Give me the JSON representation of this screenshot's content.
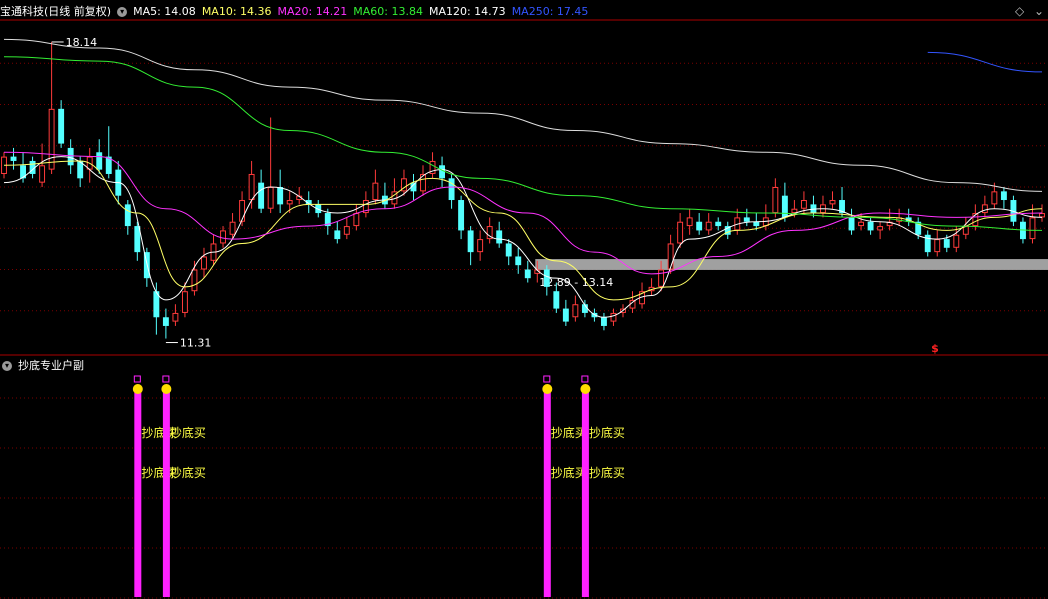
{
  "header": {
    "stock": "宝通科技(日线 前复权)",
    "ma": [
      {
        "label": "MA5: 14.08",
        "color": "#ffffff"
      },
      {
        "label": "MA10: 14.36",
        "color": "#ffff66"
      },
      {
        "label": "MA20: 14.21",
        "color": "#ff33ff"
      },
      {
        "label": "MA60: 13.84",
        "color": "#33ee33"
      },
      {
        "label": "MA120: 14.73",
        "color": "#ffffff"
      },
      {
        "label": "MA250: 17.45",
        "color": "#3355ff"
      }
    ]
  },
  "sub_header": {
    "title": "抄底专业户副"
  },
  "colors": {
    "up": "#ff3b3b",
    "down": "#54ffff",
    "grid": "#7a0000",
    "ma5": "#ffffff",
    "ma10": "#ffff66",
    "ma20": "#ff33ff",
    "ma60": "#33ee33",
    "ma120": "#dddddd",
    "ma250": "#3355ff",
    "signal": "#ff22ff",
    "signal_text": "#ffff44",
    "dot": "#ffdd00"
  },
  "chart_data": {
    "type": "candlestick",
    "y_range": [
      11.0,
      18.6
    ],
    "bar_count": 110,
    "annotations": {
      "high_label": "18.14",
      "low_label": "11.31",
      "zone_label": "12.89 - 13.14",
      "zone_range": [
        12.89,
        13.14
      ],
      "marker": "$"
    },
    "signal_label": "抄底买",
    "signals": [
      14,
      17,
      57,
      61
    ],
    "ma250_visible_from": 97,
    "candles": [
      [
        15.1,
        15.5,
        15.6,
        15.0
      ],
      [
        15.5,
        15.4,
        15.7,
        15.2
      ],
      [
        15.3,
        15.0,
        15.6,
        14.9
      ],
      [
        15.4,
        15.1,
        15.5,
        15.0
      ],
      [
        14.9,
        15.3,
        15.8,
        14.8
      ],
      [
        15.2,
        16.6,
        18.14,
        15.1
      ],
      [
        16.6,
        15.8,
        16.8,
        15.7
      ],
      [
        15.7,
        15.3,
        15.9,
        15.1
      ],
      [
        15.4,
        15.0,
        15.5,
        14.8
      ],
      [
        15.2,
        15.5,
        15.7,
        14.9
      ],
      [
        15.6,
        15.2,
        15.9,
        15.1
      ],
      [
        15.5,
        15.1,
        16.2,
        15.0
      ],
      [
        15.2,
        14.6,
        15.4,
        14.4
      ],
      [
        14.4,
        13.9,
        14.5,
        13.7
      ],
      [
        13.9,
        13.3,
        14.0,
        13.1
      ],
      [
        13.3,
        12.7,
        13.4,
        12.5
      ],
      [
        12.4,
        11.8,
        12.6,
        11.4
      ],
      [
        11.8,
        11.6,
        12.0,
        11.31
      ],
      [
        11.7,
        11.9,
        12.1,
        11.6
      ],
      [
        11.9,
        12.4,
        12.6,
        11.8
      ],
      [
        12.4,
        12.9,
        13.1,
        12.3
      ],
      [
        12.9,
        13.2,
        13.4,
        12.7
      ],
      [
        13.1,
        13.5,
        13.7,
        13.0
      ],
      [
        13.5,
        13.8,
        13.9,
        13.4
      ],
      [
        13.7,
        14.0,
        14.2,
        13.6
      ],
      [
        14.0,
        14.5,
        14.7,
        13.9
      ],
      [
        14.5,
        15.1,
        15.4,
        14.3
      ],
      [
        14.9,
        14.3,
        15.2,
        14.2
      ],
      [
        14.3,
        14.8,
        16.4,
        14.2
      ],
      [
        14.8,
        14.4,
        15.2,
        14.2
      ],
      [
        14.4,
        14.5,
        14.7,
        14.2
      ],
      [
        14.5,
        14.6,
        14.8,
        14.4
      ],
      [
        14.5,
        14.4,
        14.7,
        14.2
      ],
      [
        14.4,
        14.2,
        14.5,
        14.1
      ],
      [
        14.2,
        13.9,
        14.3,
        13.7
      ],
      [
        13.8,
        13.6,
        14.0,
        13.5
      ],
      [
        13.7,
        13.9,
        14.1,
        13.6
      ],
      [
        13.9,
        14.2,
        14.4,
        13.8
      ],
      [
        14.2,
        14.5,
        14.7,
        14.1
      ],
      [
        14.5,
        14.9,
        15.2,
        14.4
      ],
      [
        14.6,
        14.4,
        14.9,
        14.3
      ],
      [
        14.4,
        14.7,
        15.0,
        14.3
      ],
      [
        14.7,
        15.0,
        15.2,
        14.6
      ],
      [
        14.9,
        14.7,
        15.1,
        14.5
      ],
      [
        14.7,
        15.1,
        15.3,
        14.6
      ],
      [
        15.1,
        15.4,
        15.6,
        15.0
      ],
      [
        15.3,
        15.0,
        15.5,
        14.8
      ],
      [
        15.0,
        14.5,
        15.1,
        14.3
      ],
      [
        14.5,
        13.8,
        14.6,
        13.6
      ],
      [
        13.8,
        13.3,
        13.9,
        13.0
      ],
      [
        13.3,
        13.6,
        13.8,
        13.1
      ],
      [
        13.6,
        13.9,
        14.1,
        13.5
      ],
      [
        13.8,
        13.5,
        14.0,
        13.4
      ],
      [
        13.5,
        13.2,
        13.6,
        13.0
      ],
      [
        13.2,
        13.0,
        13.4,
        12.8
      ],
      [
        12.9,
        12.7,
        13.1,
        12.6
      ],
      [
        12.8,
        12.9,
        13.1,
        12.6
      ],
      [
        12.9,
        12.5,
        13.0,
        12.3
      ],
      [
        12.4,
        12.0,
        12.6,
        11.9
      ],
      [
        12.0,
        11.7,
        12.2,
        11.6
      ],
      [
        11.8,
        12.1,
        12.3,
        11.7
      ],
      [
        12.1,
        11.9,
        12.2,
        11.8
      ],
      [
        11.9,
        11.8,
        12.0,
        11.7
      ],
      [
        11.8,
        11.6,
        11.9,
        11.5
      ],
      [
        11.7,
        11.9,
        12.0,
        11.6
      ],
      [
        11.9,
        12.0,
        12.1,
        11.8
      ],
      [
        12.0,
        12.2,
        12.4,
        11.9
      ],
      [
        12.1,
        12.4,
        12.6,
        12.0
      ],
      [
        12.4,
        12.5,
        12.7,
        12.3
      ],
      [
        12.5,
        12.9,
        13.1,
        12.4
      ],
      [
        12.9,
        13.5,
        13.7,
        12.8
      ],
      [
        13.5,
        14.0,
        14.2,
        13.4
      ],
      [
        13.9,
        14.1,
        14.3,
        13.7
      ],
      [
        14.0,
        13.8,
        14.2,
        13.7
      ],
      [
        13.8,
        14.0,
        14.2,
        13.7
      ],
      [
        14.0,
        13.9,
        14.1,
        13.8
      ],
      [
        13.9,
        13.7,
        14.0,
        13.6
      ],
      [
        13.8,
        14.1,
        14.3,
        13.7
      ],
      [
        14.1,
        14.0,
        14.3,
        13.9
      ],
      [
        14.0,
        13.9,
        14.2,
        13.8
      ],
      [
        13.9,
        14.1,
        14.4,
        13.8
      ],
      [
        14.2,
        14.8,
        15.0,
        14.1
      ],
      [
        14.6,
        14.1,
        14.9,
        14.0
      ],
      [
        14.2,
        14.3,
        14.5,
        14.1
      ],
      [
        14.3,
        14.5,
        14.7,
        14.2
      ],
      [
        14.4,
        14.2,
        14.6,
        14.1
      ],
      [
        14.2,
        14.4,
        14.6,
        14.1
      ],
      [
        14.4,
        14.5,
        14.7,
        14.3
      ],
      [
        14.5,
        14.2,
        14.8,
        14.1
      ],
      [
        14.1,
        13.8,
        14.3,
        13.7
      ],
      [
        13.9,
        14.0,
        14.2,
        13.8
      ],
      [
        14.0,
        13.8,
        14.1,
        13.7
      ],
      [
        13.8,
        13.9,
        14.0,
        13.6
      ],
      [
        13.9,
        14.0,
        14.3,
        13.8
      ],
      [
        14.0,
        14.1,
        14.3,
        13.9
      ],
      [
        14.1,
        14.0,
        14.3,
        13.9
      ],
      [
        14.0,
        13.7,
        14.1,
        13.6
      ],
      [
        13.7,
        13.3,
        13.8,
        13.2
      ],
      [
        13.3,
        13.6,
        13.8,
        13.2
      ],
      [
        13.6,
        13.4,
        13.7,
        13.3
      ],
      [
        13.4,
        13.7,
        13.9,
        13.3
      ],
      [
        13.7,
        13.9,
        14.1,
        13.6
      ],
      [
        13.9,
        14.2,
        14.4,
        13.8
      ],
      [
        14.2,
        14.4,
        14.6,
        14.1
      ],
      [
        14.4,
        14.7,
        14.9,
        14.3
      ],
      [
        14.7,
        14.5,
        14.8,
        14.3
      ],
      [
        14.5,
        14.0,
        14.6,
        13.9
      ],
      [
        14.0,
        13.6,
        14.1,
        13.5
      ],
      [
        13.6,
        14.1,
        14.4,
        13.5
      ],
      [
        14.1,
        14.2,
        14.4,
        14.0
      ]
    ],
    "ma": {
      "ma5": [
        [
          0,
          14.9
        ],
        [
          6,
          15.5
        ],
        [
          12,
          14.9
        ],
        [
          17,
          12.2
        ],
        [
          22,
          13.3
        ],
        [
          28,
          14.8
        ],
        [
          35,
          14.2
        ],
        [
          40,
          14.5
        ],
        [
          46,
          15.2
        ],
        [
          52,
          13.6
        ],
        [
          58,
          12.7
        ],
        [
          63,
          11.8
        ],
        [
          68,
          12.3
        ],
        [
          72,
          13.6
        ],
        [
          79,
          14.0
        ],
        [
          86,
          14.3
        ],
        [
          92,
          14.0
        ],
        [
          98,
          13.6
        ],
        [
          104,
          14.3
        ],
        [
          109,
          14.1
        ]
      ],
      "ma10": [
        [
          0,
          15.3
        ],
        [
          8,
          15.4
        ],
        [
          14,
          14.2
        ],
        [
          19,
          12.5
        ],
        [
          25,
          13.5
        ],
        [
          32,
          14.4
        ],
        [
          38,
          14.4
        ],
        [
          45,
          15.0
        ],
        [
          52,
          14.2
        ],
        [
          58,
          13.1
        ],
        [
          64,
          12.2
        ],
        [
          70,
          12.5
        ],
        [
          77,
          13.8
        ],
        [
          85,
          14.2
        ],
        [
          93,
          14.1
        ],
        [
          99,
          13.8
        ],
        [
          104,
          14.1
        ],
        [
          109,
          14.3
        ]
      ],
      "ma20": [
        [
          0,
          15.6
        ],
        [
          10,
          15.5
        ],
        [
          17,
          14.3
        ],
        [
          24,
          13.6
        ],
        [
          32,
          13.9
        ],
        [
          40,
          14.3
        ],
        [
          47,
          14.8
        ],
        [
          55,
          14.2
        ],
        [
          62,
          13.3
        ],
        [
          68,
          12.8
        ],
        [
          75,
          13.2
        ],
        [
          83,
          13.8
        ],
        [
          92,
          14.2
        ],
        [
          100,
          14.1
        ],
        [
          109,
          14.2
        ]
      ],
      "ma60": [
        [
          0,
          17.8
        ],
        [
          10,
          17.7
        ],
        [
          20,
          17.1
        ],
        [
          30,
          16.1
        ],
        [
          40,
          15.6
        ],
        [
          50,
          15.0
        ],
        [
          60,
          14.6
        ],
        [
          70,
          14.3
        ],
        [
          80,
          14.2
        ],
        [
          90,
          14.1
        ],
        [
          100,
          13.9
        ],
        [
          109,
          13.8
        ]
      ],
      "ma120": [
        [
          0,
          18.2
        ],
        [
          10,
          18.0
        ],
        [
          20,
          17.5
        ],
        [
          30,
          17.1
        ],
        [
          40,
          16.8
        ],
        [
          50,
          16.5
        ],
        [
          60,
          16.1
        ],
        [
          70,
          15.8
        ],
        [
          80,
          15.6
        ],
        [
          90,
          15.3
        ],
        [
          100,
          14.9
        ],
        [
          109,
          14.7
        ]
      ],
      "ma250": [
        [
          97,
          17.9
        ],
        [
          109,
          17.45
        ]
      ]
    }
  }
}
